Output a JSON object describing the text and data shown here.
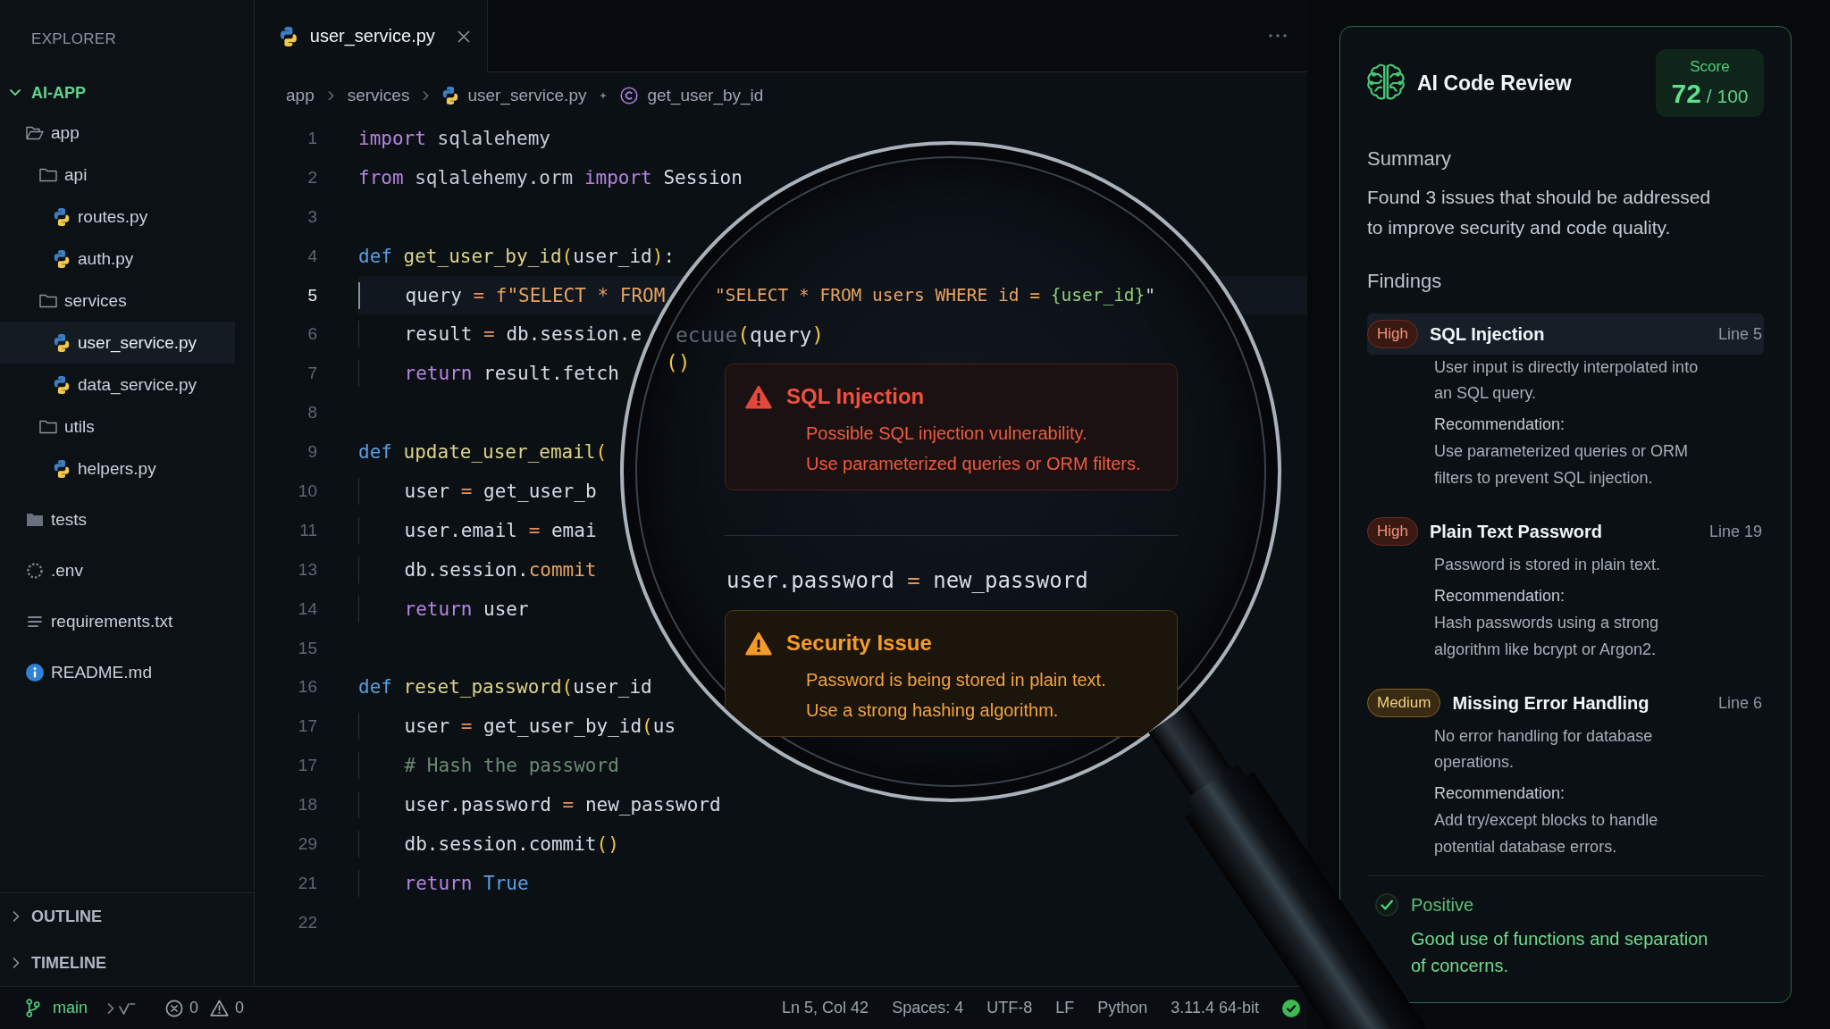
{
  "sidebar": {
    "title": "EXPLORER",
    "project": {
      "label": "AI-APP",
      "expanded": true
    },
    "tree": [
      {
        "label": "app",
        "kind": "folder",
        "expanded": true,
        "selected": false,
        "children": [
          {
            "label": "api",
            "kind": "folder",
            "expanded": true,
            "selected": false,
            "children": [
              {
                "label": "routes.py",
                "kind": "python",
                "selected": false
              },
              {
                "label": "auth.py",
                "kind": "python",
                "selected": false
              }
            ]
          },
          {
            "label": "services",
            "kind": "folder",
            "expanded": true,
            "selected": false,
            "children": [
              {
                "label": "user_service.py",
                "kind": "python",
                "selected": true
              },
              {
                "label": "data_service.py",
                "kind": "python",
                "selected": false
              }
            ]
          },
          {
            "label": "utils",
            "kind": "folder",
            "expanded": true,
            "selected": false,
            "children": [
              {
                "label": "helpers.py",
                "kind": "python",
                "selected": false
              }
            ]
          }
        ]
      },
      {
        "label": "tests",
        "kind": "folder",
        "expanded": false,
        "selected": false
      },
      {
        "label": ".env",
        "kind": "env",
        "selected": false
      },
      {
        "label": "requirements.txt",
        "kind": "text",
        "selected": false
      },
      {
        "label": "README.md",
        "kind": "info",
        "selected": false
      }
    ],
    "sections": [
      {
        "label": "OUTLINE",
        "expanded": false
      },
      {
        "label": "TIMELINE",
        "expanded": false
      }
    ]
  },
  "editor": {
    "tabs": [
      {
        "label": "user_service.py",
        "kind": "python",
        "selected": true
      }
    ],
    "breadcrumb": [
      {
        "label": "app",
        "kind": "folder"
      },
      {
        "label": "services",
        "kind": "folder"
      },
      {
        "label": "user_service.py",
        "kind": "python"
      },
      {
        "label": "get_user_by_id",
        "kind": "method"
      }
    ],
    "lines": [
      {
        "number": "1",
        "current": false,
        "tokens": [
          {
            "text": "import",
            "kind": "keyword"
          },
          {
            "text": " sqlalehemy",
            "kind": "module"
          }
        ]
      },
      {
        "number": "2",
        "current": false,
        "tokens": [
          {
            "text": "from",
            "kind": "keyword"
          },
          {
            "text": " sqlalehemy.orm ",
            "kind": "module"
          },
          {
            "text": "import",
            "kind": "keyword"
          },
          {
            "text": " Session",
            "kind": "plain"
          }
        ]
      },
      {
        "number": "3",
        "current": false
      },
      {
        "number": "4",
        "current": false,
        "tokens": [
          {
            "text": "def",
            "kind": "storage"
          },
          {
            "text": " get_user_by_id",
            "kind": "function"
          },
          {
            "text": "(",
            "kind": "paren"
          },
          {
            "text": "user_id",
            "kind": "plain"
          },
          {
            "text": ")",
            "kind": "paren"
          },
          {
            "text": ":",
            "kind": "plain"
          }
        ]
      },
      {
        "number": "5",
        "current": true,
        "tokens": [
          {
            "text": "    query",
            "kind": "plain"
          },
          {
            "text": " = ",
            "kind": "operator"
          },
          {
            "text": "f\"SELECT * FROM",
            "kind": "string"
          }
        ]
      },
      {
        "number": "6",
        "current": false,
        "tokens": [
          {
            "text": "    result",
            "kind": "plain"
          },
          {
            "text": " = ",
            "kind": "operator"
          },
          {
            "text": "db.session.e",
            "kind": "plain"
          }
        ]
      },
      {
        "number": "7",
        "current": false,
        "tokens": [
          {
            "text": "    return",
            "kind": "keyword"
          },
          {
            "text": " result.fetch",
            "kind": "plain"
          }
        ]
      },
      {
        "number": "8",
        "current": false
      },
      {
        "number": "9",
        "current": false,
        "tokens": [
          {
            "text": "def",
            "kind": "storage"
          },
          {
            "text": " update_user_email",
            "kind": "function"
          },
          {
            "text": "(",
            "kind": "paren"
          }
        ]
      },
      {
        "number": "10",
        "current": false,
        "tokens": [
          {
            "text": "    user",
            "kind": "plain"
          },
          {
            "text": " = ",
            "kind": "operator"
          },
          {
            "text": "get_user_b",
            "kind": "plain"
          }
        ]
      },
      {
        "number": "11",
        "current": false,
        "tokens": [
          {
            "text": "    user.email",
            "kind": "plain"
          },
          {
            "text": " = ",
            "kind": "operator"
          },
          {
            "text": "emai",
            "kind": "plain"
          }
        ]
      },
      {
        "number": "13",
        "current": false,
        "tokens": [
          {
            "text": "    db.session.",
            "kind": "plain"
          },
          {
            "text": "commit",
            "kind": "method"
          }
        ]
      },
      {
        "number": "14",
        "current": false,
        "tokens": [
          {
            "text": "    return",
            "kind": "keyword"
          },
          {
            "text": " user",
            "kind": "plain"
          }
        ]
      },
      {
        "number": "15",
        "current": false
      },
      {
        "number": "16",
        "current": false,
        "tokens": [
          {
            "text": "def",
            "kind": "storage"
          },
          {
            "text": " reset_password",
            "kind": "function"
          },
          {
            "text": "(",
            "kind": "paren"
          },
          {
            "text": "user_id",
            "kind": "plain"
          }
        ]
      },
      {
        "number": "17",
        "current": false,
        "tokens": [
          {
            "text": "    user",
            "kind": "plain"
          },
          {
            "text": " = ",
            "kind": "operator"
          },
          {
            "text": "get_user_by_id",
            "kind": "plain"
          },
          {
            "text": "(",
            "kind": "paren"
          },
          {
            "text": "us",
            "kind": "plain"
          }
        ]
      },
      {
        "number": "17",
        "current": false,
        "tokens": [
          {
            "text": "    # Hash the password",
            "kind": "comment"
          }
        ]
      },
      {
        "number": "18",
        "current": false,
        "tokens": [
          {
            "text": "    user.password",
            "kind": "plain"
          },
          {
            "text": " = ",
            "kind": "operator"
          },
          {
            "text": "new_password",
            "kind": "plain"
          }
        ]
      },
      {
        "number": "29",
        "current": false,
        "tokens": [
          {
            "text": "    db.session.commit",
            "kind": "plain"
          },
          {
            "text": "()",
            "kind": "paren"
          }
        ]
      },
      {
        "number": "21",
        "current": false,
        "tokens": [
          {
            "text": "    return",
            "kind": "keyword"
          },
          {
            "text": " True",
            "kind": "constant"
          }
        ]
      },
      {
        "number": "22",
        "current": false
      }
    ]
  },
  "magnifier": {
    "items": [
      {
        "kind": "code",
        "tokens": [
          {
            "text": "\"SELECT * FROM users WHERE id = ",
            "kind": "string"
          },
          {
            "text": "{user_id}",
            "kind": "interpolation"
          },
          {
            "text": "\"",
            "kind": "plain"
          }
        ]
      },
      {
        "kind": "code",
        "tokens": [
          {
            "text": "ecuue",
            "kind": "faded"
          },
          {
            "text": "(",
            "kind": "paren"
          },
          {
            "text": "query",
            "kind": "plain"
          },
          {
            "text": ")",
            "kind": "paren"
          }
        ]
      },
      {
        "kind": "code",
        "tokens": [
          {
            "text": "()",
            "kind": "paren"
          }
        ]
      },
      {
        "kind": "error",
        "title": "SQL Injection",
        "lines": [
          "Possible SQL injection vulnerability.",
          "Use parameterized queries or ORM filters."
        ]
      },
      {
        "kind": "code",
        "tokens": [
          {
            "text": "user.password",
            "kind": "plain"
          },
          {
            "text": " = ",
            "kind": "operator"
          },
          {
            "text": "new_password",
            "kind": "plain"
          }
        ]
      },
      {
        "kind": "warning",
        "title": "Security Issue",
        "lines": [
          "Password is being stored in plain text.",
          "Use a strong hashing algorithm."
        ]
      }
    ]
  },
  "status_bar": {
    "branch": "main",
    "errors": "0",
    "warnings": "0",
    "items": [
      "Ln 5, Col 42",
      "Spaces: 4",
      "UTF-8",
      "LF",
      "Python",
      "3.11.4 64-bit"
    ]
  },
  "review": {
    "title": "AI Code Review",
    "score": {
      "label": "Score",
      "value": "72",
      "total": "/ 100"
    },
    "summary": {
      "heading": "Summary",
      "text": "Found 3 issues that should be addressed\nto improve security and code quality."
    },
    "findings_heading": "Findings",
    "findings": [
      {
        "kind": "high",
        "severity": "High",
        "title": "SQL Injection",
        "line": "Line 5",
        "selected": true,
        "description": "User input is directly interpolated into\nan SQL query.",
        "recommendation_label": "Recommendation:",
        "recommendation": "Use parameterized queries or ORM\nfilters to prevent SQL injection."
      },
      {
        "kind": "high",
        "severity": "High",
        "title": "Plain Text Password",
        "line": "Line 19",
        "selected": false,
        "description": "Password is stored in plain text.",
        "recommendation_label": "Recommendation:",
        "recommendation": "Hash passwords using a strong\nalgorithm like bcrypt or Argon2."
      },
      {
        "kind": "medium",
        "severity": "Medium",
        "title": "Missing Error Handling",
        "line": "Line 6",
        "selected": false,
        "description": "No error handling for database\noperations.",
        "recommendation_label": "Recommendation:",
        "recommendation": "Add try/except blocks to handle\npotential database errors."
      }
    ],
    "positive": {
      "label": "Positive",
      "text": "Good use of functions and separation\nof concerns."
    }
  }
}
